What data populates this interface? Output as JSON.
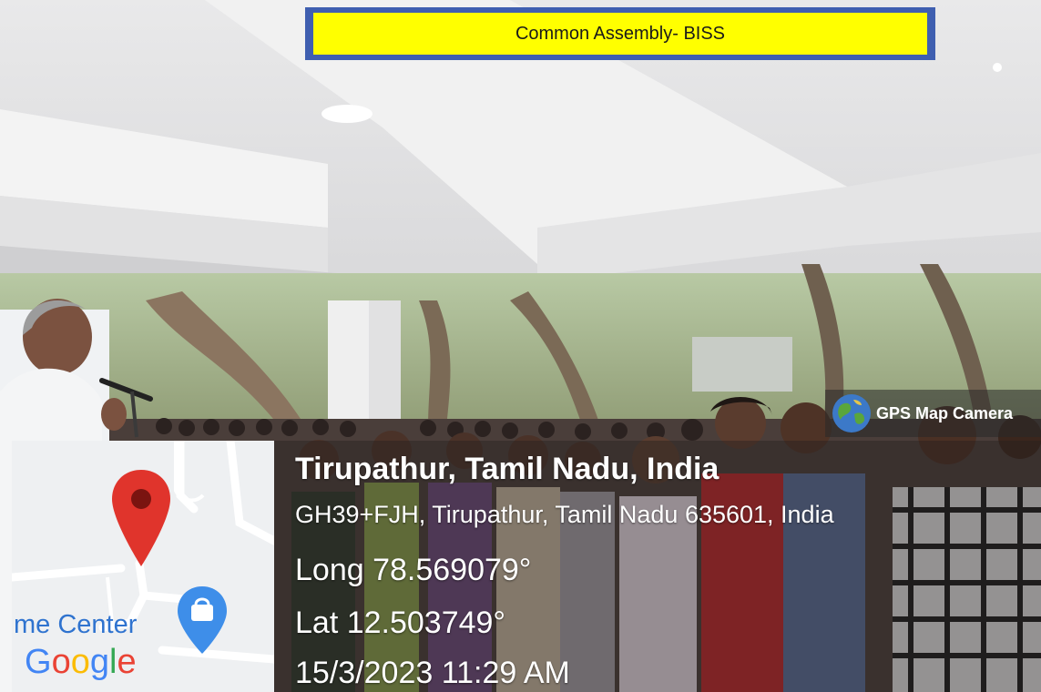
{
  "banner": {
    "title": "Common Assembly- BISS"
  },
  "gps_badge": {
    "label": "GPS Map Camera"
  },
  "location": {
    "place": "Tirupathur, Tamil Nadu, India",
    "address": "GH39+FJH, Tirupathur, Tamil Nadu 635601, India",
    "longitude": "Long 78.569079°",
    "latitude": "Lat 12.503749°",
    "timestamp": "15/3/2023 11:29 AM"
  },
  "map": {
    "place_label": "me Center",
    "google_letters": [
      "G",
      "o",
      "o",
      "g",
      "l",
      "e"
    ],
    "google_colors": [
      "#4285F4",
      "#EA4335",
      "#FBBC05",
      "#4285F4",
      "#34A853",
      "#EA4335"
    ],
    "pin_color": "#e0342c",
    "shopping_pin_color": "#3e8ee9"
  }
}
